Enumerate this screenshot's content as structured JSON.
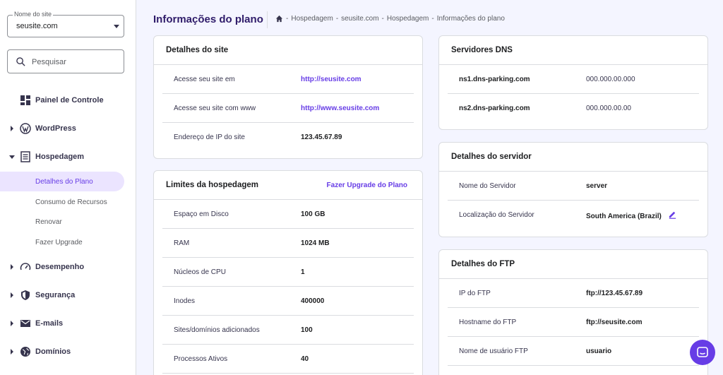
{
  "sidebar": {
    "site_select": {
      "label": "Nome do site",
      "value": "seusite.com"
    },
    "search": {
      "placeholder": "Pesquisar"
    },
    "items": [
      {
        "label": "Painel de Controle",
        "icon": "dashboard-icon"
      },
      {
        "label": "WordPress",
        "icon": "wordpress-icon"
      },
      {
        "label": "Hospedagem",
        "icon": "server-icon"
      },
      {
        "label": "Desempenho",
        "icon": "gauge-icon"
      },
      {
        "label": "Segurança",
        "icon": "shield-icon"
      },
      {
        "label": "E-mails",
        "icon": "mail-icon"
      },
      {
        "label": "Domínios",
        "icon": "globe-icon"
      }
    ],
    "sub_items": [
      {
        "label": "Detalhes do Plano",
        "active": true
      },
      {
        "label": "Consumo de Recursos"
      },
      {
        "label": "Renovar"
      },
      {
        "label": "Fazer Upgrade"
      }
    ]
  },
  "header": {
    "title": "Informações do plano",
    "breadcrumb": [
      "Hospedagem",
      "seusite.com",
      "Hospedagem",
      "Informações do plano"
    ],
    "separator": "-"
  },
  "site_details": {
    "title": "Detalhes do site",
    "rows": [
      {
        "key": "Acesse seu site em",
        "value": "http://seusite.com"
      },
      {
        "key": "Acesse seu site com www",
        "value": "http://www.seusite.com"
      },
      {
        "key": "Endereço de IP do site",
        "value": "123.45.67.89"
      }
    ]
  },
  "limits": {
    "title": "Limites da hospedagem",
    "action": "Fazer Upgrade do Plano",
    "rows": [
      {
        "key": "Espaço em Disco",
        "value": "100 GB"
      },
      {
        "key": "RAM",
        "value": "1024 MB"
      },
      {
        "key": "Núcleos de CPU",
        "value": "1"
      },
      {
        "key": "Inodes",
        "value": "400000"
      },
      {
        "key": "Sites/domínios adicionados",
        "value": "100"
      },
      {
        "key": "Processos Ativos",
        "value": "40"
      }
    ]
  },
  "dns": {
    "title": "Servidores DNS",
    "rows": [
      {
        "key": "ns1.dns-parking.com",
        "value": "000.000.00.000"
      },
      {
        "key": "ns2.dns-parking.com",
        "value": "000.000.00.00"
      }
    ]
  },
  "server": {
    "title": "Detalhes do servidor",
    "rows": [
      {
        "key": "Nome do Servidor",
        "value": "server"
      },
      {
        "key": "Localização do Servidor",
        "value": "South America (Brazil)"
      }
    ]
  },
  "ftp": {
    "title": "Detalhes do FTP",
    "rows": [
      {
        "key": "IP do FTP",
        "value": "ftp://123.45.67.89"
      },
      {
        "key": "Hostname do FTP",
        "value": "ftp://seusite.com"
      },
      {
        "key": "Nome de usuário FTP",
        "value": "usuario"
      }
    ]
  },
  "colors": {
    "accent": "#673de6",
    "title": "#2f1c6a",
    "background": "#f4f5ff"
  }
}
